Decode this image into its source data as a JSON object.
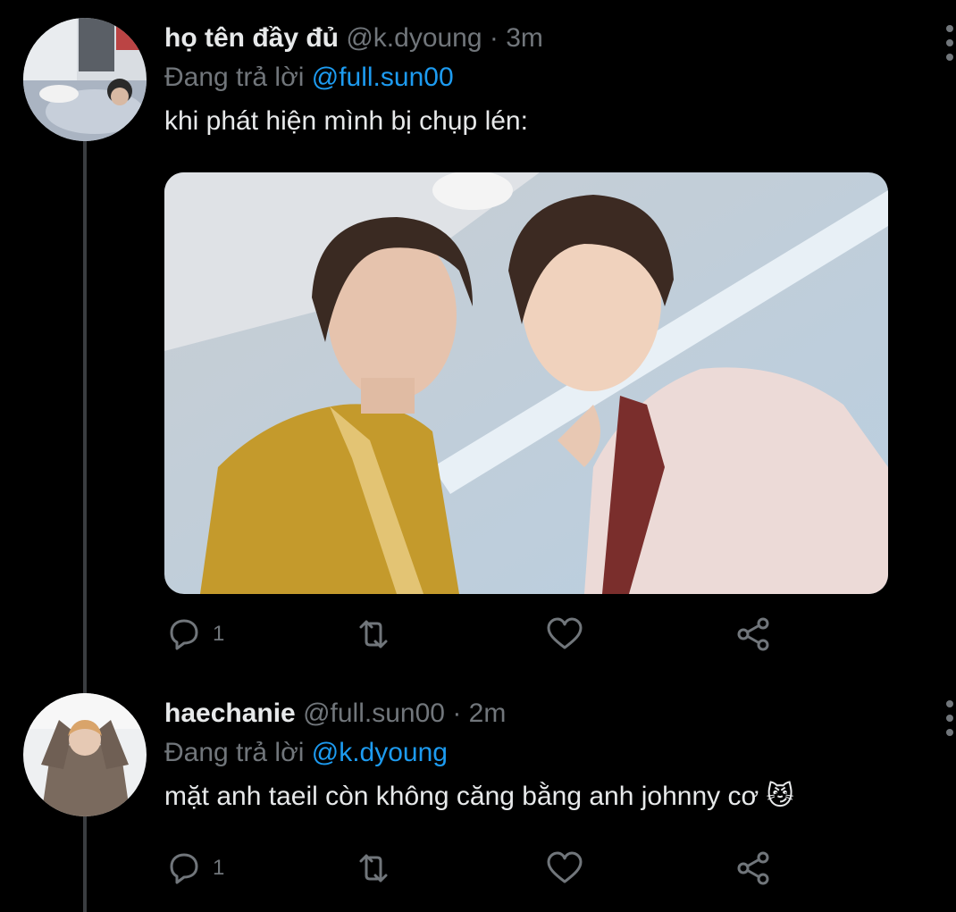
{
  "tweets": [
    {
      "name": "họ tên đầy đủ",
      "handle": "@k.dyoung",
      "separator": "·",
      "time": "3m",
      "reply_prefix": "Đang trả lời",
      "reply_to": "@full.sun00",
      "text": "khi phát hiện mình bị chụp lén:",
      "reply_count": "1"
    },
    {
      "name": "haechanie",
      "handle": "@full.sun00",
      "separator": "·",
      "time": "2m",
      "reply_prefix": "Đang trả lời",
      "reply_to": "@k.dyoung",
      "text": "mặt anh taeil còn không căng bằng anh johnny cơ 😼",
      "reply_count": "1"
    }
  ],
  "icons": [
    "reply-icon",
    "retweet-icon",
    "like-icon",
    "share-icon",
    "more-icon"
  ],
  "colors": {
    "background": "#000000",
    "text": "#e7e9ea",
    "muted": "#71767b",
    "link": "#1d9bf0"
  }
}
